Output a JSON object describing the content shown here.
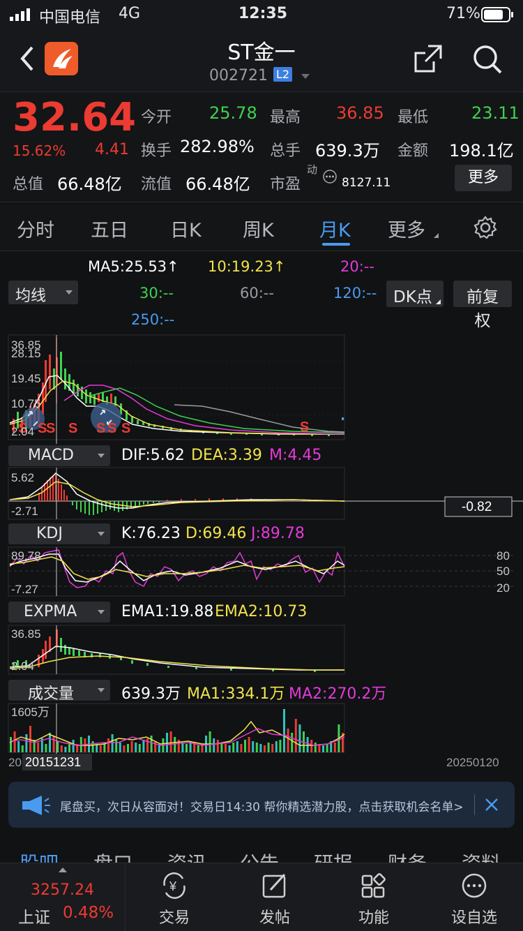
{
  "status_bar": {
    "carrier": "中国电信",
    "network": "4G",
    "time": "12:35",
    "battery": "71%"
  },
  "header": {
    "title": "ST金一",
    "code": "002721",
    "level_badge": "L2"
  },
  "quote": {
    "price": "32.64",
    "change_pct": "15.62%",
    "change_amt": "4.41",
    "open_label": "今开",
    "open": "25.78",
    "high_label": "最高",
    "high": "36.85",
    "low_label": "最低",
    "low": "23.11",
    "turnover_label": "换手",
    "turnover": "282.98%",
    "volume_label": "总手",
    "volume": "639.3万",
    "amount_label": "金额",
    "amount": "198.1亿",
    "mktcap_label": "总值",
    "mktcap": "66.48亿",
    "float_label": "流值",
    "float_cap": "66.48亿",
    "pe_label": "市盈",
    "pe_sup": "动",
    "pe": "8127.11",
    "more_button": "更多"
  },
  "tabs": [
    "分时",
    "五日",
    "日K",
    "周K",
    "月K",
    "更多"
  ],
  "active_tab": "月K",
  "ma_legend": {
    "ma5": "MA5:25.53↑",
    "ma10": "10:19.23↑",
    "ma20": "20:--",
    "ma30": "30:--",
    "ma60": "60:--",
    "ma120": "120:--",
    "ma250": "250:--",
    "select": "均线",
    "dk_button": "DK点",
    "adjust_button": "前复权"
  },
  "main_chart": {
    "y_labels": [
      "36.85",
      "28.15",
      "19.45",
      "10.75",
      "2.04"
    ],
    "signal": "S"
  },
  "macd": {
    "select": "MACD",
    "dif": "DIF:5.62",
    "dea": "DEA:3.39",
    "m": "M:4.45",
    "y_top": "5.62",
    "y_bottom": "-2.71",
    "crosshair_value": "-0.82"
  },
  "kdj": {
    "select": "KDJ",
    "k": "K:76.23",
    "d": "D:69.46",
    "j": "J:89.78",
    "y_top": "89.78",
    "y_bottom": "-7.27",
    "levels": [
      "80",
      "50",
      "20"
    ]
  },
  "expma": {
    "select": "EXPMA",
    "ema1": "EMA1:19.88",
    "ema2": "EMA2:10.73",
    "y_top": "36.85",
    "y_bottom": "2.04"
  },
  "volume": {
    "select": "成交量",
    "vol": "639.3万",
    "ma1": "MA1:334.1万",
    "ma2": "MA2:270.2万",
    "y_top": "1605万",
    "start_prefix": "20",
    "crosshair_date": "20151231",
    "end_date": "20250120"
  },
  "banner": {
    "text": "尾盘买，次日从容面对！交易日14:30 帮你精选潜力股，点击获取机会名单>"
  },
  "sub_tabs": [
    "股吧",
    "盘口",
    "资讯",
    "公告",
    "研报",
    "财务",
    "资料"
  ],
  "bottom_nav": {
    "index_value": "3257.24",
    "index_name": "上证",
    "index_change": "0.48%",
    "items": [
      "交易",
      "发帖",
      "功能",
      "设自选"
    ]
  },
  "colors": {
    "up": "#ec3b32",
    "down": "#3fd150",
    "accent": "#4a9bf0"
  }
}
